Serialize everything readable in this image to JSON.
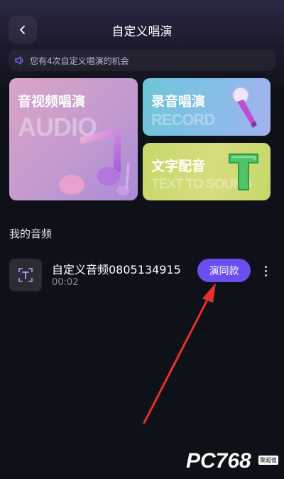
{
  "header": {
    "title": "自定义唱演"
  },
  "notice": {
    "text": "您有4次自定义唱演的机会"
  },
  "cards": {
    "main": {
      "title": "音视频唱演",
      "watermark": "AUDIO"
    },
    "record": {
      "title": "录音唱演",
      "watermark": "RECORD"
    },
    "tts": {
      "title": "文字配音",
      "watermark": "TEXT TO SOUND"
    }
  },
  "section": {
    "title": "我的音频"
  },
  "audio_items": [
    {
      "name": "自定义音频0805134915",
      "duration": "00:02",
      "action_label": "演同款"
    }
  ],
  "watermark": {
    "logo": "PC768",
    "badge": "聚超值"
  },
  "colors": {
    "background": "#0f1118",
    "accent": "#6b4df0",
    "annotation_arrow": "#e8302a"
  }
}
